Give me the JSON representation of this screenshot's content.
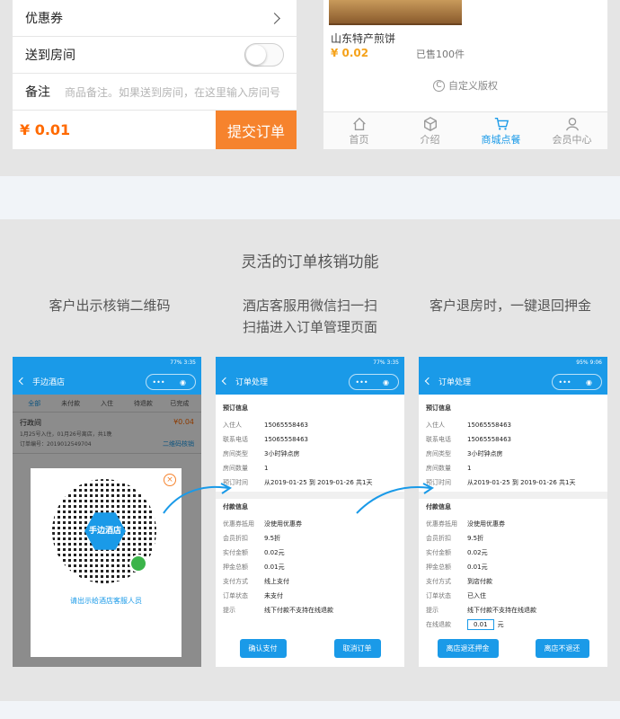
{
  "order_form": {
    "coupon_label": "优惠券",
    "deliver_label": "送到房间",
    "remark_label": "备注",
    "remark_placeholder": "商品备注。如果送到房间，在这里输入房间号",
    "total": "¥ 0.01",
    "submit_label": "提交订单"
  },
  "shop": {
    "product_name": "山东特产煎饼",
    "product_price": "¥ 0.02",
    "product_sold": "已售100件",
    "copyright": "自定义版权",
    "tabs": [
      {
        "label": "首页",
        "icon": "home-icon"
      },
      {
        "label": "介绍",
        "icon": "cube-icon"
      },
      {
        "label": "商城点餐",
        "icon": "cart-icon",
        "active": true
      },
      {
        "label": "会员中心",
        "icon": "user-icon"
      }
    ]
  },
  "feature": {
    "title": "灵活的订单核销功能",
    "step1": "客户出示核销二维码",
    "step2_line1": "酒店客服用微信扫一扫",
    "step2_line2": "扫描进入订单管理页面",
    "step3": "客户退房时，一键退回押金"
  },
  "phone1": {
    "status": "77% 3:35",
    "title": "手边酒店",
    "tabs": [
      "全部",
      "未付款",
      "入住",
      "待退款",
      "已完成"
    ],
    "order_title": "行政间",
    "order_dates": "1月25号入住，01月26号离店，共1晚",
    "order_no": "订单编号：2019012549704",
    "order_price": "¥0.04",
    "order_action": "二维码核销",
    "qr_text": "手边酒店",
    "popup_tip": "请出示给酒店客服人员"
  },
  "phone2": {
    "status": "77% 3:35",
    "title": "订单处理",
    "section1": "预订信息",
    "rows1": [
      {
        "k": "入住人",
        "v": "15065558463"
      },
      {
        "k": "联系电话",
        "v": "15065558463"
      },
      {
        "k": "房间类型",
        "v": "3小时钟点房"
      },
      {
        "k": "房间数量",
        "v": "1"
      },
      {
        "k": "预订时间",
        "v": "从2019-01-25 到 2019-01-26 共1天"
      }
    ],
    "section2": "付款信息",
    "rows2": [
      {
        "k": "优惠券抵用",
        "v": "没使用优惠券"
      },
      {
        "k": "会员折扣",
        "v": "9.5折"
      },
      {
        "k": "实付金额",
        "v": "0.02元"
      },
      {
        "k": "押金总额",
        "v": "0.01元"
      },
      {
        "k": "支付方式",
        "v": "线上支付"
      },
      {
        "k": "订单状态",
        "v": "未支付"
      },
      {
        "k": "提示",
        "v": "线下付款不支持在线退款"
      }
    ],
    "btn1": "确认支付",
    "btn2": "取消订单"
  },
  "phone3": {
    "status": "95% 9:06",
    "title": "订单处理",
    "section1": "预订信息",
    "rows1": [
      {
        "k": "入住人",
        "v": "15065558463"
      },
      {
        "k": "联系电话",
        "v": "15065558463"
      },
      {
        "k": "房间类型",
        "v": "3小时钟点房"
      },
      {
        "k": "房间数量",
        "v": "1"
      },
      {
        "k": "预订时间",
        "v": "从2019-01-25 到 2019-01-26 共1天"
      }
    ],
    "section2": "付款信息",
    "rows2": [
      {
        "k": "优惠券抵用",
        "v": "没使用优惠券"
      },
      {
        "k": "会员折扣",
        "v": "9.5折"
      },
      {
        "k": "实付金额",
        "v": "0.02元"
      },
      {
        "k": "押金总额",
        "v": "0.01元"
      },
      {
        "k": "支付方式",
        "v": "到店付款"
      },
      {
        "k": "订单状态",
        "v": "已入住"
      },
      {
        "k": "提示",
        "v": "线下付款不支持在线退款"
      }
    ],
    "refund_label": "在线退款",
    "refund_value": "0.01",
    "refund_unit": "元",
    "btn1": "离店退还押金",
    "btn2": "离店不退还"
  }
}
